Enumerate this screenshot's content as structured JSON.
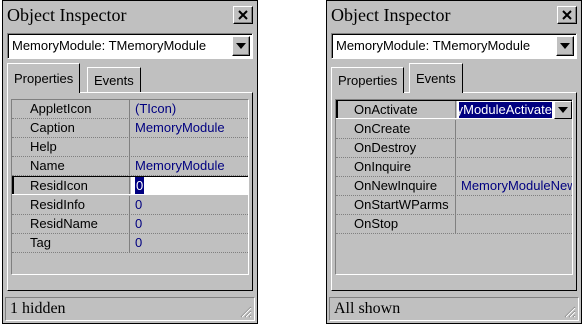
{
  "left": {
    "title": "Object Inspector",
    "combo_value": "MemoryModule: TMemoryModule",
    "tabs": [
      "Properties",
      "Events"
    ],
    "rows": [
      {
        "name": "AppletIcon",
        "value": "(TIcon)"
      },
      {
        "name": "Caption",
        "value": "MemoryModule"
      },
      {
        "name": "Help",
        "value": ""
      },
      {
        "name": "Name",
        "value": "MemoryModule"
      },
      {
        "name": "ResidIcon",
        "value": "0"
      },
      {
        "name": "ResidInfo",
        "value": "0"
      },
      {
        "name": "ResidName",
        "value": "0"
      },
      {
        "name": "Tag",
        "value": "0"
      }
    ],
    "status": "1 hidden"
  },
  "right": {
    "title": "Object Inspector",
    "combo_value": "MemoryModule: TMemoryModule",
    "tabs": [
      "Properties",
      "Events"
    ],
    "rows": [
      {
        "name": "OnActivate",
        "value": "MemoryModuleActivate"
      },
      {
        "name": "OnCreate",
        "value": ""
      },
      {
        "name": "OnDestroy",
        "value": ""
      },
      {
        "name": "OnInquire",
        "value": ""
      },
      {
        "name": "OnNewInquire",
        "value": "MemoryModuleNewI"
      },
      {
        "name": "OnStartWParms",
        "value": ""
      },
      {
        "name": "OnStop",
        "value": ""
      }
    ],
    "status": "All shown"
  },
  "icons": [
    "close-icon",
    "chevron-down-icon",
    "size-grip-icon"
  ]
}
